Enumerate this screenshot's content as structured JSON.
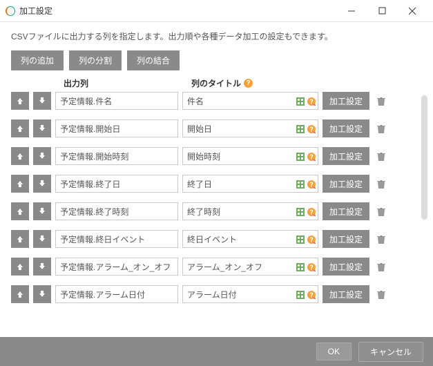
{
  "window": {
    "title": "加工設定"
  },
  "description": "CSVファイルに出力する列を指定します。出力順や各種データ加工の設定もできます。",
  "toolbar": {
    "add": "列の追加",
    "split": "列の分割",
    "join": "列の結合"
  },
  "headers": {
    "output": "出力列",
    "title": "列のタイトル"
  },
  "row_labels": {
    "processing": "加工設定"
  },
  "footer": {
    "ok": "OK",
    "cancel": "キャンセル"
  },
  "rows": [
    {
      "out": "予定情報.件名",
      "title": "件名"
    },
    {
      "out": "予定情報.開始日",
      "title": "開始日"
    },
    {
      "out": "予定情報.開始時刻",
      "title": "開始時刻"
    },
    {
      "out": "予定情報.終了日",
      "title": "終了日"
    },
    {
      "out": "予定情報.終了時刻",
      "title": "終了時刻"
    },
    {
      "out": "予定情報.終日イベント",
      "title": "終日イベント"
    },
    {
      "out": "予定情報.アラーム_オン_オフ",
      "title": "アラーム_オン_オフ"
    },
    {
      "out": "予定情報.アラーム日付",
      "title": "アラーム日付"
    }
  ]
}
